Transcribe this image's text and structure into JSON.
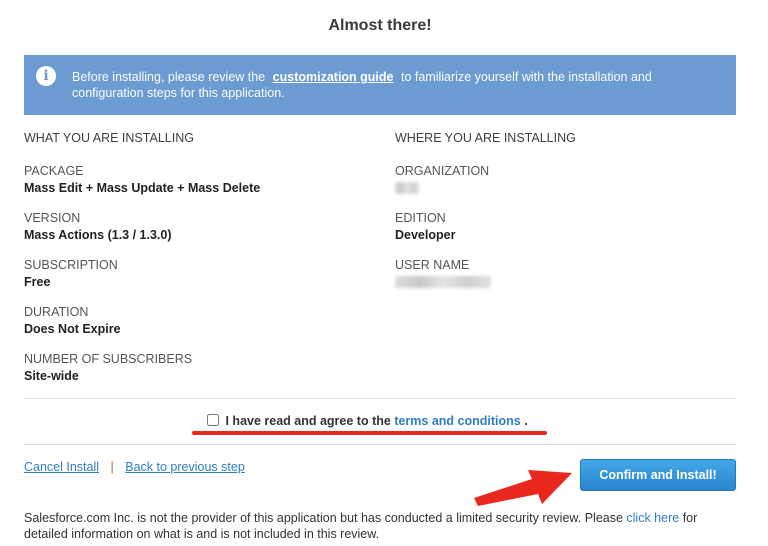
{
  "title": "Almost there!",
  "banner": {
    "text_before": "Before installing, please review the",
    "link": "customization guide",
    "text_after": "to familiarize yourself with the installation and configuration steps for this application."
  },
  "installing": {
    "heading": "WHAT YOU ARE INSTALLING",
    "fields": [
      {
        "label": "PACKAGE",
        "value": "Mass Edit + Mass Update + Mass Delete"
      },
      {
        "label": "VERSION",
        "value": "Mass Actions (1.3 / 1.3.0)"
      },
      {
        "label": "SUBSCRIPTION",
        "value": "Free"
      },
      {
        "label": "DURATION",
        "value": "Does Not Expire"
      },
      {
        "label": "NUMBER OF SUBSCRIBERS",
        "value": "Site-wide"
      }
    ]
  },
  "where": {
    "heading": "WHERE YOU ARE INSTALLING",
    "organization_label": "ORGANIZATION",
    "edition_label": "EDITION",
    "edition_value": "Developer",
    "username_label": "USER NAME"
  },
  "agreement": {
    "text": "I have read and agree to the",
    "link": "terms and conditions",
    "period": ".",
    "checked": false
  },
  "nav": {
    "cancel": "Cancel Install",
    "separator": "|",
    "back": "Back to previous step"
  },
  "confirm_label": "Confirm and Install!",
  "footer": {
    "text_before": "Salesforce.com Inc. is not the provider of this application but has conducted a limited security review. Please",
    "link": "click here",
    "text_after": "for detailed information on what is and is not included in this review."
  },
  "colors": {
    "banner": "#6b9bd1",
    "link": "#2e7ec1",
    "button": "#3696dc",
    "annotation": "#e8281c"
  },
  "icons": {
    "info": "info-icon",
    "arrow": "red-arrow-annotation"
  }
}
